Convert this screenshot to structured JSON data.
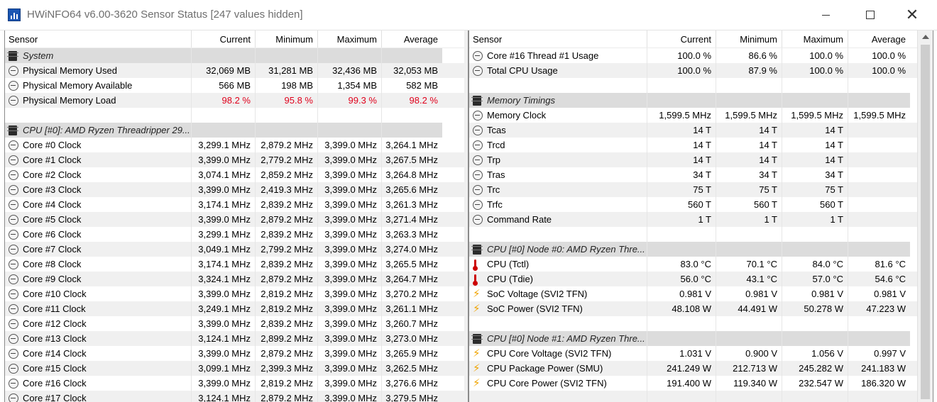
{
  "window": {
    "title": "HWiNFO64 v6.00-3620 Sensor Status [247 values hidden]",
    "min": "—",
    "max": "",
    "close": "✕"
  },
  "columns": {
    "sensor": "Sensor",
    "current": "Current",
    "minimum": "Minimum",
    "maximum": "Maximum",
    "average": "Average"
  },
  "left_rows": [
    {
      "type": "group",
      "icon": "chip",
      "name": "System"
    },
    {
      "type": "data",
      "icon": "clock",
      "name": "Physical Memory Used",
      "current": "32,069 MB",
      "minimum": "31,281 MB",
      "maximum": "32,436 MB",
      "average": "32,053 MB"
    },
    {
      "type": "data",
      "icon": "clock",
      "name": "Physical Memory Available",
      "current": "566 MB",
      "minimum": "198 MB",
      "maximum": "1,354 MB",
      "average": "582 MB"
    },
    {
      "type": "data",
      "icon": "clock",
      "name": "Physical Memory Load",
      "current": "98.2 %",
      "minimum": "95.8 %",
      "maximum": "99.3 %",
      "average": "98.2 %",
      "alert": true
    },
    {
      "type": "blank"
    },
    {
      "type": "group",
      "icon": "chip",
      "name": "CPU [#0]: AMD Ryzen Threadripper 29..."
    },
    {
      "type": "data",
      "icon": "clock",
      "name": "Core #0 Clock",
      "current": "3,299.1 MHz",
      "minimum": "2,879.2 MHz",
      "maximum": "3,399.0 MHz",
      "average": "3,264.1 MHz"
    },
    {
      "type": "data",
      "icon": "clock",
      "name": "Core #1 Clock",
      "current": "3,399.0 MHz",
      "minimum": "2,779.2 MHz",
      "maximum": "3,399.0 MHz",
      "average": "3,267.5 MHz"
    },
    {
      "type": "data",
      "icon": "clock",
      "name": "Core #2 Clock",
      "current": "3,074.1 MHz",
      "minimum": "2,859.2 MHz",
      "maximum": "3,399.0 MHz",
      "average": "3,264.8 MHz"
    },
    {
      "type": "data",
      "icon": "clock",
      "name": "Core #3 Clock",
      "current": "3,399.0 MHz",
      "minimum": "2,419.3 MHz",
      "maximum": "3,399.0 MHz",
      "average": "3,265.6 MHz"
    },
    {
      "type": "data",
      "icon": "clock",
      "name": "Core #4 Clock",
      "current": "3,174.1 MHz",
      "minimum": "2,839.2 MHz",
      "maximum": "3,399.0 MHz",
      "average": "3,261.3 MHz"
    },
    {
      "type": "data",
      "icon": "clock",
      "name": "Core #5 Clock",
      "current": "3,399.0 MHz",
      "minimum": "2,879.2 MHz",
      "maximum": "3,399.0 MHz",
      "average": "3,271.4 MHz"
    },
    {
      "type": "data",
      "icon": "clock",
      "name": "Core #6 Clock",
      "current": "3,299.1 MHz",
      "minimum": "2,839.2 MHz",
      "maximum": "3,399.0 MHz",
      "average": "3,263.3 MHz"
    },
    {
      "type": "data",
      "icon": "clock",
      "name": "Core #7 Clock",
      "current": "3,049.1 MHz",
      "minimum": "2,799.2 MHz",
      "maximum": "3,399.0 MHz",
      "average": "3,274.0 MHz"
    },
    {
      "type": "data",
      "icon": "clock",
      "name": "Core #8 Clock",
      "current": "3,174.1 MHz",
      "minimum": "2,839.2 MHz",
      "maximum": "3,399.0 MHz",
      "average": "3,265.5 MHz"
    },
    {
      "type": "data",
      "icon": "clock",
      "name": "Core #9 Clock",
      "current": "3,324.1 MHz",
      "minimum": "2,879.2 MHz",
      "maximum": "3,399.0 MHz",
      "average": "3,264.7 MHz"
    },
    {
      "type": "data",
      "icon": "clock",
      "name": "Core #10 Clock",
      "current": "3,399.0 MHz",
      "minimum": "2,819.2 MHz",
      "maximum": "3,399.0 MHz",
      "average": "3,270.2 MHz"
    },
    {
      "type": "data",
      "icon": "clock",
      "name": "Core #11 Clock",
      "current": "3,249.1 MHz",
      "minimum": "2,819.2 MHz",
      "maximum": "3,399.0 MHz",
      "average": "3,261.1 MHz"
    },
    {
      "type": "data",
      "icon": "clock",
      "name": "Core #12 Clock",
      "current": "3,399.0 MHz",
      "minimum": "2,839.2 MHz",
      "maximum": "3,399.0 MHz",
      "average": "3,260.7 MHz"
    },
    {
      "type": "data",
      "icon": "clock",
      "name": "Core #13 Clock",
      "current": "3,124.1 MHz",
      "minimum": "2,899.2 MHz",
      "maximum": "3,399.0 MHz",
      "average": "3,273.0 MHz"
    },
    {
      "type": "data",
      "icon": "clock",
      "name": "Core #14 Clock",
      "current": "3,399.0 MHz",
      "minimum": "2,879.2 MHz",
      "maximum": "3,399.0 MHz",
      "average": "3,265.9 MHz"
    },
    {
      "type": "data",
      "icon": "clock",
      "name": "Core #15 Clock",
      "current": "3,099.1 MHz",
      "minimum": "2,399.3 MHz",
      "maximum": "3,399.0 MHz",
      "average": "3,262.5 MHz"
    },
    {
      "type": "data",
      "icon": "clock",
      "name": "Core #16 Clock",
      "current": "3,399.0 MHz",
      "minimum": "2,819.2 MHz",
      "maximum": "3,399.0 MHz",
      "average": "3,276.6 MHz"
    },
    {
      "type": "data",
      "icon": "clock",
      "name": "Core #17 Clock",
      "current": "3,124.1 MHz",
      "minimum": "2,879.2 MHz",
      "maximum": "3,399.0 MHz",
      "average": "3,279.5 MHz"
    }
  ],
  "right_rows": [
    {
      "type": "data",
      "icon": "clock",
      "name": "Core #16 Thread #1 Usage",
      "current": "100.0 %",
      "minimum": "86.6 %",
      "maximum": "100.0 %",
      "average": "100.0 %"
    },
    {
      "type": "data",
      "icon": "clock",
      "name": "Total CPU Usage",
      "current": "100.0 %",
      "minimum": "87.9 %",
      "maximum": "100.0 %",
      "average": "100.0 %"
    },
    {
      "type": "blank"
    },
    {
      "type": "group",
      "icon": "chip",
      "name": "Memory Timings"
    },
    {
      "type": "data",
      "icon": "clock",
      "name": "Memory Clock",
      "current": "1,599.5 MHz",
      "minimum": "1,599.5 MHz",
      "maximum": "1,599.5 MHz",
      "average": "1,599.5 MHz"
    },
    {
      "type": "data",
      "icon": "clock",
      "name": "Tcas",
      "current": "14 T",
      "minimum": "14 T",
      "maximum": "14 T",
      "average": ""
    },
    {
      "type": "data",
      "icon": "clock",
      "name": "Trcd",
      "current": "14 T",
      "minimum": "14 T",
      "maximum": "14 T",
      "average": ""
    },
    {
      "type": "data",
      "icon": "clock",
      "name": "Trp",
      "current": "14 T",
      "minimum": "14 T",
      "maximum": "14 T",
      "average": ""
    },
    {
      "type": "data",
      "icon": "clock",
      "name": "Tras",
      "current": "34 T",
      "minimum": "34 T",
      "maximum": "34 T",
      "average": ""
    },
    {
      "type": "data",
      "icon": "clock",
      "name": "Trc",
      "current": "75 T",
      "minimum": "75 T",
      "maximum": "75 T",
      "average": ""
    },
    {
      "type": "data",
      "icon": "clock",
      "name": "Trfc",
      "current": "560 T",
      "minimum": "560 T",
      "maximum": "560 T",
      "average": ""
    },
    {
      "type": "data",
      "icon": "clock",
      "name": "Command Rate",
      "current": "1 T",
      "minimum": "1 T",
      "maximum": "1 T",
      "average": ""
    },
    {
      "type": "blank"
    },
    {
      "type": "group",
      "icon": "chip",
      "name": "CPU [#0] Node #0: AMD Ryzen Thre..."
    },
    {
      "type": "data",
      "icon": "therm",
      "name": "CPU (Tctl)",
      "current": "83.0 °C",
      "minimum": "70.1 °C",
      "maximum": "84.0 °C",
      "average": "81.6 °C"
    },
    {
      "type": "data",
      "icon": "therm",
      "name": "CPU (Tdie)",
      "current": "56.0 °C",
      "minimum": "43.1 °C",
      "maximum": "57.0 °C",
      "average": "54.6 °C"
    },
    {
      "type": "data",
      "icon": "bolt",
      "name": "SoC Voltage (SVI2 TFN)",
      "current": "0.981 V",
      "minimum": "0.981 V",
      "maximum": "0.981 V",
      "average": "0.981 V"
    },
    {
      "type": "data",
      "icon": "bolt",
      "name": "SoC Power (SVI2 TFN)",
      "current": "48.108 W",
      "minimum": "44.491 W",
      "maximum": "50.278 W",
      "average": "47.223 W"
    },
    {
      "type": "blank"
    },
    {
      "type": "group",
      "icon": "chip",
      "name": "CPU [#0] Node #1: AMD Ryzen Thre..."
    },
    {
      "type": "data",
      "icon": "bolt",
      "name": "CPU Core Voltage (SVI2 TFN)",
      "current": "1.031 V",
      "minimum": "0.900 V",
      "maximum": "1.056 V",
      "average": "0.997 V"
    },
    {
      "type": "data",
      "icon": "bolt",
      "name": "CPU Package Power (SMU)",
      "current": "241.249 W",
      "minimum": "212.713 W",
      "maximum": "245.282 W",
      "average": "241.183 W"
    },
    {
      "type": "data",
      "icon": "bolt",
      "name": "CPU Core Power (SVI2 TFN)",
      "current": "191.400 W",
      "minimum": "119.340 W",
      "maximum": "232.547 W",
      "average": "186.320 W"
    },
    {
      "type": "blank"
    }
  ],
  "colors": {
    "alert": "#e0001b",
    "group_bg": "#dcdcdc",
    "row_shade": "#f0f0f0"
  }
}
